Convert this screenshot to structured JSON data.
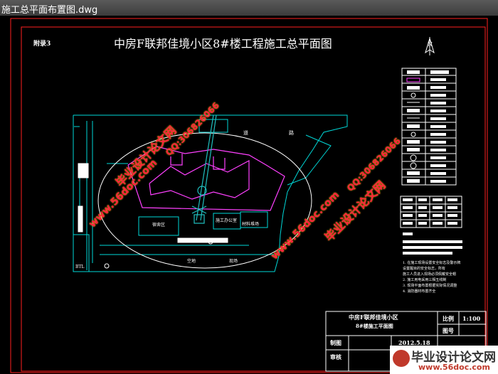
{
  "window": {
    "title": "施工总平面布置图.dwg"
  },
  "drawing": {
    "appendix": "附录3",
    "title": "中房F联邦佳境小区8#楼工程施工总平面图",
    "north": "N",
    "site_labels": {
      "road_1": "道",
      "road_2": "路",
      "office": "施工办公室",
      "residential": "宿舍区",
      "lot": "空地",
      "site": "现场",
      "storage": "材料堆场",
      "left_tag": "BTL"
    },
    "legend_text_rows": [
      "2",
      "3",
      "4",
      "5",
      "6",
      "7",
      "8",
      "9"
    ],
    "notes": [
      "1. 在施工现场设置安全标志及警示牌",
      "设置醒目的安全标志，所有",
      "施工人员进入现场必须佩戴安全帽",
      "2. 施工用电采用三相五线制",
      "3. 现场平面布置根据实际情况调整",
      "4. 消防器材布置齐全"
    ]
  },
  "title_block": {
    "project_line1": "中房F联邦佳境小区",
    "project_line2": "8#楼施工平面图",
    "scale_label": "比例",
    "scale_value": "1:100",
    "drawing_no_label": "图号",
    "drawn_label": "制图",
    "date_value": "2012.5.18",
    "checked_label": "审核"
  },
  "watermarks": {
    "site_name": "毕业设计论文网",
    "url": "www.56doc.com",
    "qq": "QQ:306826066"
  },
  "logo": {
    "name": "毕业设计论文网",
    "url": "www.56doc.com"
  },
  "colors": {
    "frame": "#ff2020",
    "boundary": "#00d8d8",
    "building": "#ff40ff",
    "crane": "#20c0c0",
    "white": "#ffffff",
    "wm_red": "#ff2040",
    "wm_yellow": "#ffe000"
  }
}
